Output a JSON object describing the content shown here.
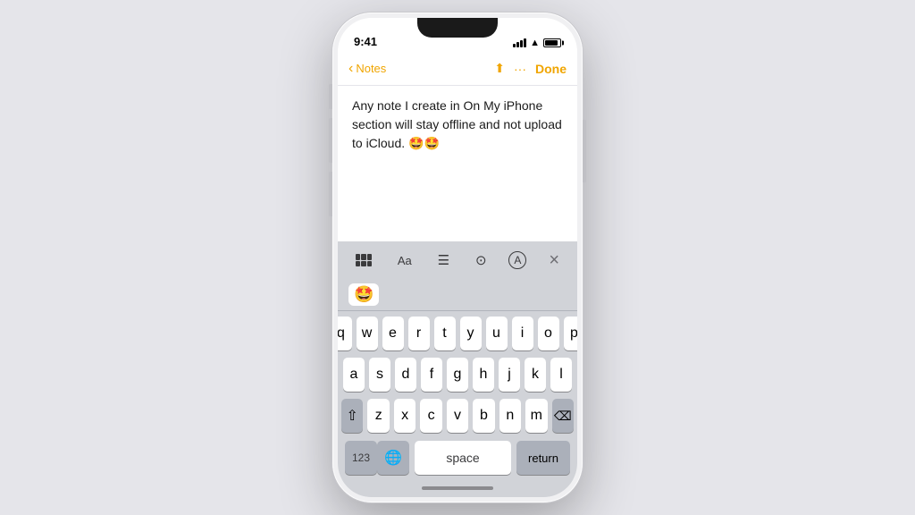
{
  "status": {
    "time": "9:41",
    "battery_level": "85%"
  },
  "nav": {
    "back_label": "Notes",
    "done_label": "Done"
  },
  "note": {
    "content": "Any note I create in On My iPhone section will stay offline and not upload to iCloud. 🤩🤩"
  },
  "keyboard": {
    "row1": [
      "q",
      "w",
      "e",
      "r",
      "t",
      "y",
      "u",
      "i",
      "o",
      "p"
    ],
    "row2": [
      "a",
      "s",
      "d",
      "f",
      "g",
      "h",
      "j",
      "k",
      "l"
    ],
    "row3": [
      "z",
      "x",
      "c",
      "v",
      "b",
      "n",
      "m"
    ],
    "space_label": "space",
    "return_label": "return",
    "numbers_label": "123"
  },
  "emoji_suggestion": "🤩",
  "format_toolbar": {
    "aa_label": "Aa",
    "close_label": "×"
  }
}
